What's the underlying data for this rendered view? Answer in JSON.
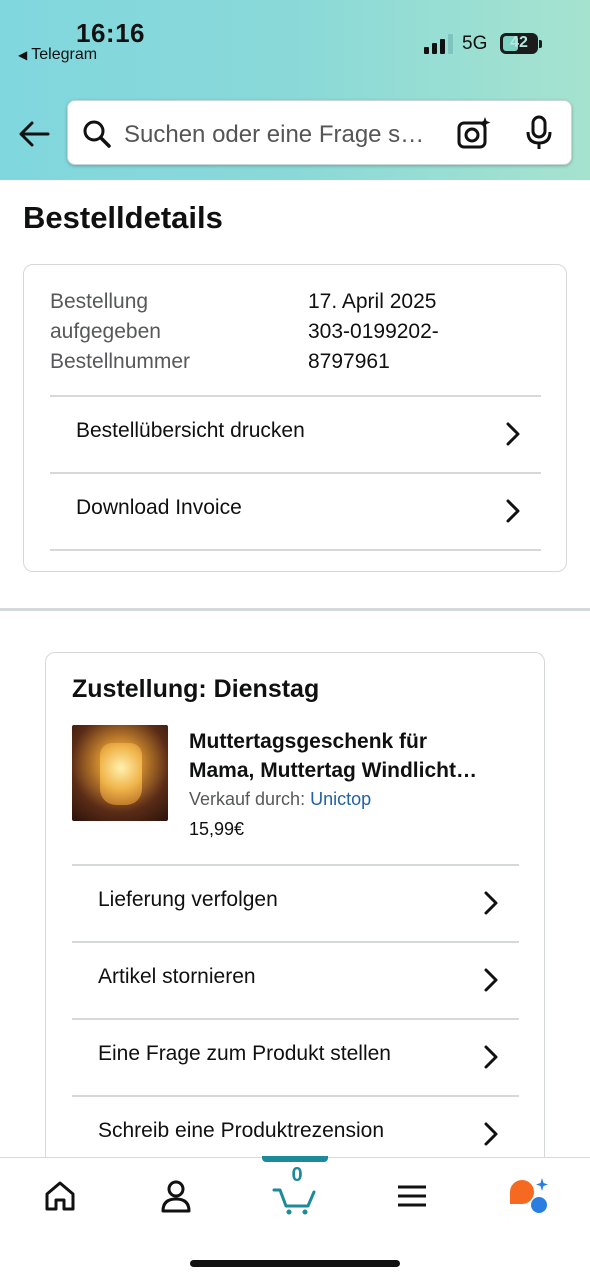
{
  "status_bar": {
    "time": "16:16",
    "back_app": "Telegram",
    "network": "5G",
    "battery": "42"
  },
  "search": {
    "placeholder": "Suchen oder eine Frage s…"
  },
  "page": {
    "title": "Bestelldetails"
  },
  "order": {
    "labels": "Bestellung\naufgegeben\nBestellnummer",
    "values": "17. April 2025\n303-0199202-\n8797961",
    "actions": [
      {
        "label": "Bestellübersicht drucken"
      },
      {
        "label": "Download Invoice"
      }
    ]
  },
  "delivery": {
    "title": "Zustellung: Dienstag",
    "product": {
      "title_line1": "Muttertagsgeschenk für",
      "title_line2": "Mama, Muttertag Windlicht…",
      "seller_prefix": "Verkauf durch: ",
      "seller_name": "Unictop",
      "price": "15,99€"
    },
    "actions": [
      {
        "label": "Lieferung verfolgen"
      },
      {
        "label": "Artikel stornieren"
      },
      {
        "label": "Eine Frage zum Produkt stellen"
      },
      {
        "label": "Schreib eine Produktrezension"
      }
    ]
  },
  "bottom_nav": {
    "cart_count": "0",
    "items": [
      "home-icon",
      "account-icon",
      "cart-icon",
      "menu-icon",
      "rufus-icon"
    ]
  },
  "colors": {
    "accent": "#1b8a9a",
    "link": "#2162a1",
    "rufus_orange": "#f56a20",
    "rufus_blue": "#2a7de1"
  }
}
